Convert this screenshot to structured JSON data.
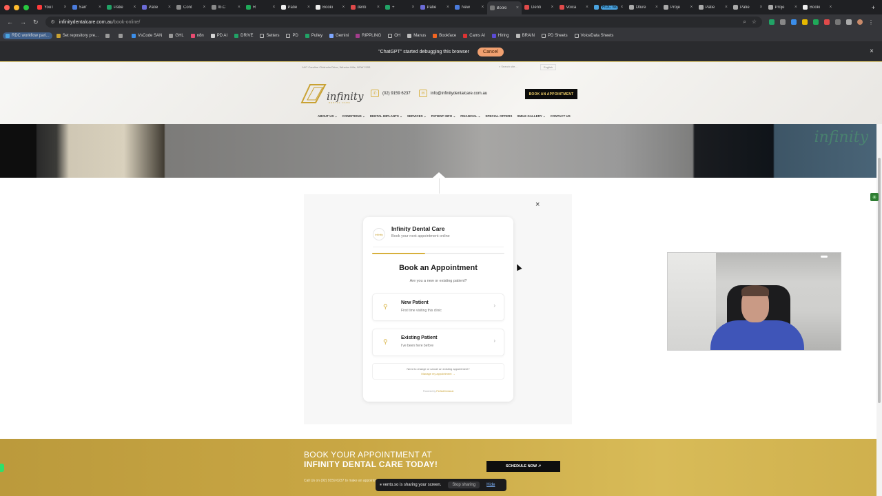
{
  "browser": {
    "tabs": [
      {
        "label": "YouT",
        "color": "#ff3b3b",
        "active": false
      },
      {
        "label": "San'",
        "color": "#4a7bdc",
        "active": false
      },
      {
        "label": "Patie",
        "color": "#21a366",
        "active": false
      },
      {
        "label": "Patie",
        "color": "#6b6bd6",
        "active": false
      },
      {
        "label": "Cont",
        "color": "#8a8a8a",
        "active": false
      },
      {
        "label": "fb.C",
        "color": "#8a8a8a",
        "active": false
      },
      {
        "label": "R",
        "color": "#1faa59",
        "active": false
      },
      {
        "label": "Patie",
        "color": "#eeeeee",
        "active": false
      },
      {
        "label": "Booki",
        "color": "#eeeeee",
        "active": false
      },
      {
        "label": "denti",
        "color": "#e04a4a",
        "active": false
      },
      {
        "label": "+",
        "color": "#21a366",
        "active": false
      },
      {
        "label": "Patie",
        "color": "#6b6bd6",
        "active": false
      },
      {
        "label": "New",
        "color": "#4a7bdc",
        "active": false
      },
      {
        "label": "Booki",
        "color": "#777777",
        "active": true
      },
      {
        "label": "Denti",
        "color": "#e04a4a",
        "active": false
      },
      {
        "label": "Voica",
        "color": "#e04a4a",
        "active": false
      },
      {
        "label": "RDC workflow",
        "color": "#4aa3df",
        "active": false,
        "highlight": true
      },
      {
        "label": "Oture",
        "color": "#aaaaaa",
        "active": false
      },
      {
        "label": "Proje",
        "color": "#aaaaaa",
        "active": false
      },
      {
        "label": "Patie",
        "color": "#aaaaaa",
        "active": false
      },
      {
        "label": "Patie",
        "color": "#aaaaaa",
        "active": false
      },
      {
        "label": "Proje",
        "color": "#aaaaaa",
        "active": false
      },
      {
        "label": "Booki",
        "color": "#eeeeee",
        "active": false
      }
    ],
    "new_tab": "+",
    "url_host": "infinitydentalcare.com.au",
    "url_path": "/book-online/",
    "bookmarks": [
      {
        "label": "RDC workflow pari...",
        "color": "#4aa3df",
        "folder": false,
        "first": true
      },
      {
        "label": "Set repository pre...",
        "color": "#c9a233",
        "folder": false
      },
      {
        "label": "",
        "color": "#999999",
        "folder": false
      },
      {
        "label": "",
        "color": "#999999",
        "folder": false
      },
      {
        "label": "VsCode SAN",
        "color": "#3b8eea",
        "folder": false
      },
      {
        "label": "GHL",
        "color": "#999999",
        "folder": false
      },
      {
        "label": "n8n",
        "color": "#ea4b71",
        "folder": false
      },
      {
        "label": "PD AI",
        "color": "#d3d3d3",
        "folder": false
      },
      {
        "label": "DRIVE",
        "color": "#21a366",
        "folder": false
      },
      {
        "label": "Setters",
        "color": "#bbbbbb",
        "folder": true
      },
      {
        "label": "PD",
        "color": "#bbbbbb",
        "folder": true
      },
      {
        "label": "Pulley",
        "color": "#21a366",
        "folder": false
      },
      {
        "label": "Gemini",
        "color": "#7ea7ff",
        "folder": false
      },
      {
        "label": "RIPPLING",
        "color": "#a33d8c",
        "folder": false
      },
      {
        "label": "OH",
        "color": "#bbbbbb",
        "folder": true
      },
      {
        "label": "Manus",
        "color": "#bbbbbb",
        "folder": false
      },
      {
        "label": "Bookface",
        "color": "#f26522",
        "folder": false
      },
      {
        "label": "Cams AI",
        "color": "#d33",
        "folder": false
      },
      {
        "label": "Hiring",
        "color": "#5b4bd6",
        "folder": false
      },
      {
        "label": "BRAIN",
        "color": "#bbbbbb",
        "folder": false
      },
      {
        "label": "PD Sheets",
        "color": "#bbbbbb",
        "folder": true
      },
      {
        "label": "VoiceData Sheets",
        "color": "#bbbbbb",
        "folder": true
      }
    ],
    "debug_message": "\"ChatGPT\" started debugging this browser",
    "debug_cancel": "Cancel",
    "debug_close": "×"
  },
  "site": {
    "top_address": "1A/7 Caroline Chisholm Drive, Winston Hills, NSW 2153",
    "search_placeholder": "Search site...",
    "language": "English",
    "logo_text": "infinity",
    "logo_sub": "DENTAL CARE",
    "phone": "(02) 9159 6237",
    "email": "info@infinitydentalcare.com.au",
    "book_button": "BOOK AN APPOINTMENT",
    "nav": [
      "ABOUT US ⌄",
      "CONDITIONS ⌄",
      "DENTAL IMPLANTS ⌄",
      "SERVICES ⌄",
      "PATIENT INFO ⌄",
      "FINANCIAL ⌄",
      "SPECIAL OFFERS",
      "SMILE GALLERY ⌄",
      "CONTACT US"
    ],
    "hero_logo": "infinity",
    "modal_close": "×"
  },
  "widget": {
    "avatar_text": "infinity",
    "title": "Infinity Dental Care",
    "subtitle": "Book your next appointment online",
    "progress": 0.4,
    "heading": "Book an Appointment",
    "question": "Are you a new or existing patient?",
    "options": [
      {
        "title": "New Patient",
        "subtitle": "First time visiting this clinic",
        "icon": "person-plus-icon"
      },
      {
        "title": "Existing Patient",
        "subtitle": "I've been here before",
        "icon": "person-icon"
      }
    ],
    "manage_text": "Need to change or cancel an existing appointment?",
    "manage_link": "Manage my appointment →",
    "powered_prefix": "Powered by",
    "powered_brand": "PerfectDental.ai"
  },
  "cta": {
    "line1": "BOOK YOUR APPOINTMENT AT",
    "line2": "INFINITY DENTAL CARE TODAY!",
    "call": "Call Us on (02) 9159 6237 to make an appointment",
    "button": "SCHEDULE NOW ↗"
  },
  "share": {
    "message": "vento.so is sharing your screen.",
    "stop": "Stop sharing",
    "hide": "Hide"
  }
}
